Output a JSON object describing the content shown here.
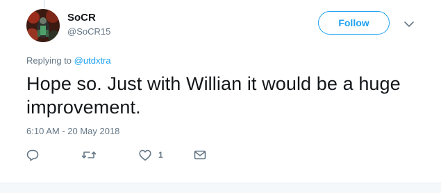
{
  "tweet": {
    "display_name": "SoCR",
    "handle": "@SoCR15",
    "follow_label": "Follow",
    "replying_prefix": "Replying to",
    "replying_to": "@utdxtra",
    "text": "Hope so. Just with Willian it would be a huge improvement.",
    "timestamp": "6:10 AM - 20 May 2018",
    "like_count": "1"
  },
  "icons": {
    "reply": "reply-icon",
    "retweet": "retweet-icon",
    "like": "heart-icon",
    "message": "envelope-icon",
    "caret": "chevron-down-icon"
  },
  "colors": {
    "accent": "#1da1f2",
    "secondary_text": "#657786",
    "primary_text": "#14171a",
    "icon_gray": "#657786"
  }
}
